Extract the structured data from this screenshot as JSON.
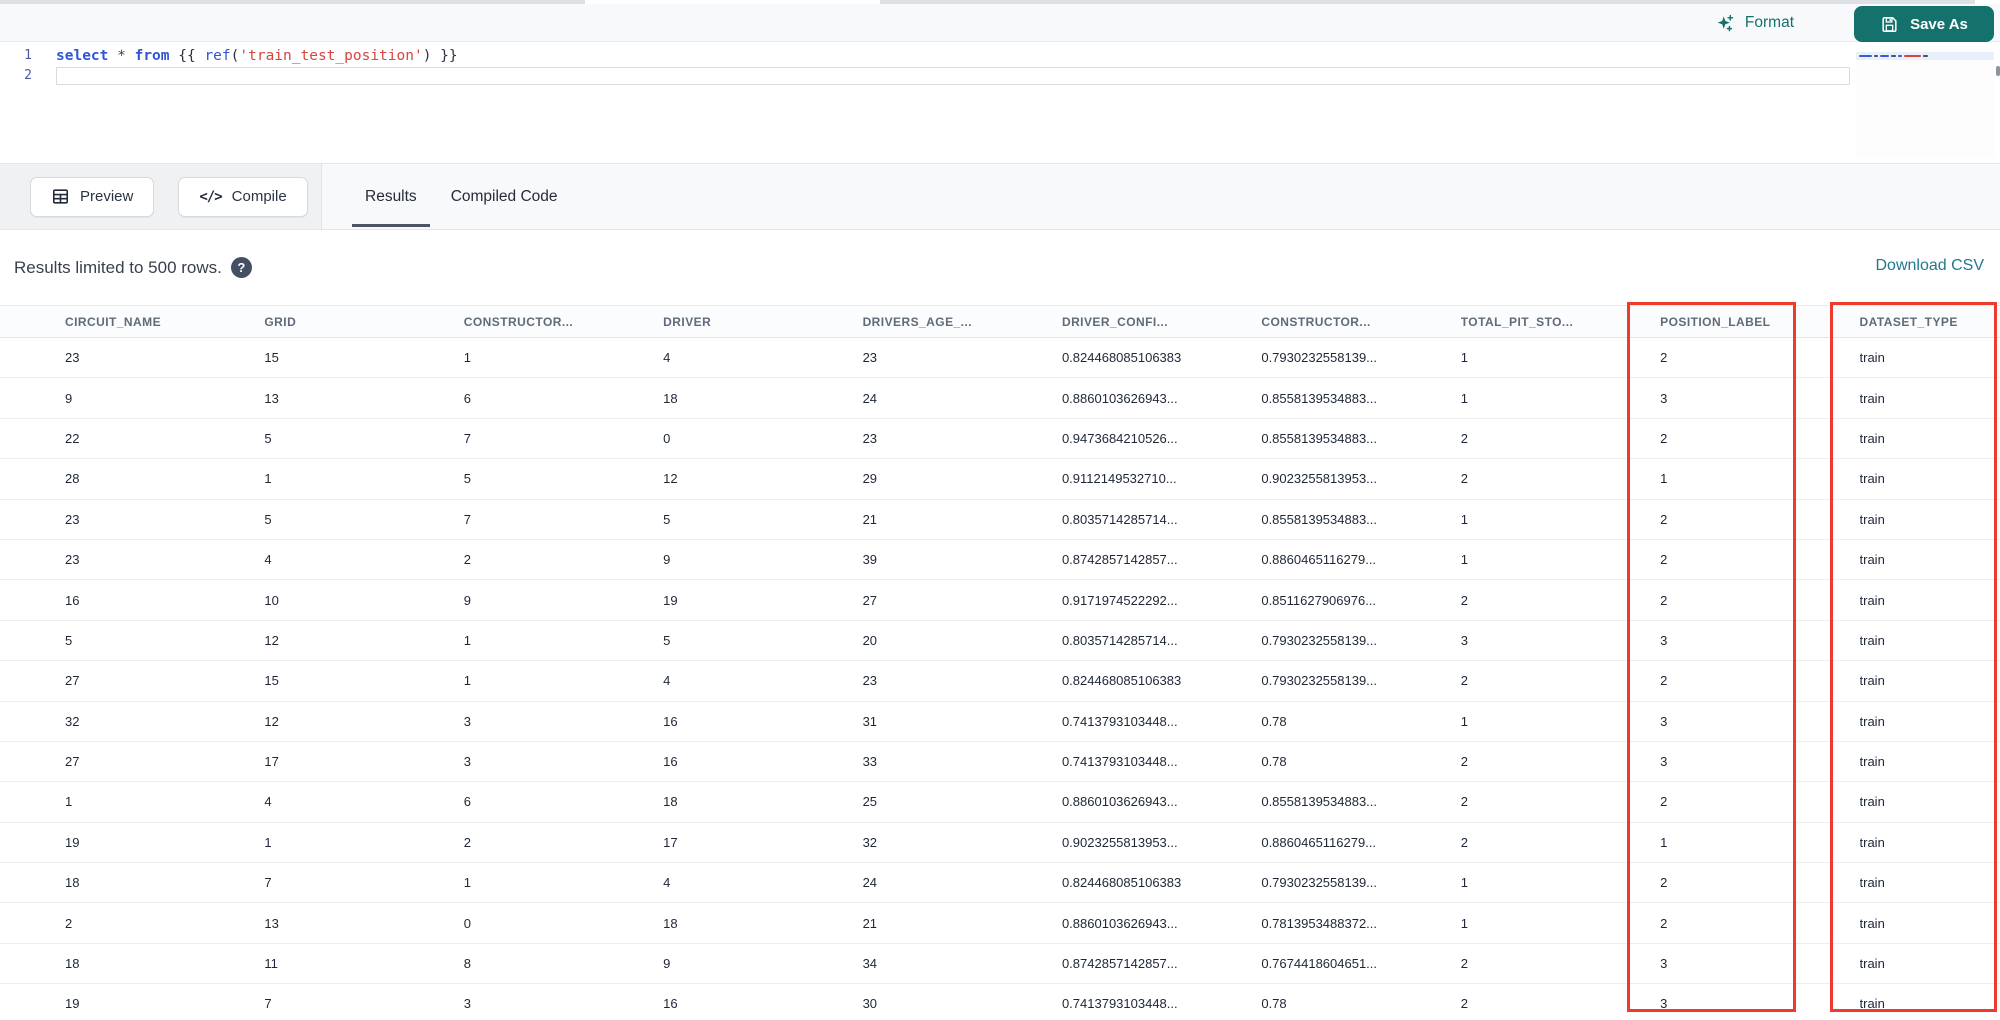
{
  "header": {
    "format_label": "Format",
    "save_as_label": "Save As",
    "accent_teal": "#15716b"
  },
  "editor": {
    "line_numbers": [
      "1",
      "2"
    ],
    "code_tokens": [
      {
        "text": "select",
        "type": "keyword"
      },
      {
        "text": " ",
        "type": "plain"
      },
      {
        "text": "*",
        "type": "operator"
      },
      {
        "text": " ",
        "type": "plain"
      },
      {
        "text": "from",
        "type": "keyword"
      },
      {
        "text": " {{ ",
        "type": "brace"
      },
      {
        "text": "ref",
        "type": "function"
      },
      {
        "text": "(",
        "type": "brace"
      },
      {
        "text": "'train_test_position'",
        "type": "string"
      },
      {
        "text": ") ",
        "type": "brace"
      },
      {
        "text": "}}",
        "type": "brace"
      }
    ]
  },
  "toolbar": {
    "preview_label": "Preview",
    "compile_label": "Compile",
    "compile_glyph": "</>",
    "tabs": [
      {
        "label": "Results",
        "active": true
      },
      {
        "label": "Compiled Code",
        "active": false
      }
    ]
  },
  "results": {
    "limit_note": "Results limited to 500 rows.",
    "help_glyph": "?",
    "download_label": "Download CSV"
  },
  "table": {
    "columns": [
      "CIRCUIT_NAME",
      "GRID",
      "CONSTRUCTOR...",
      "DRIVER",
      "DRIVERS_AGE_...",
      "DRIVER_CONFI...",
      "CONSTRUCTOR...",
      "TOTAL_PIT_STO...",
      "POSITION_LABEL",
      "DATASET_TYPE"
    ],
    "rows": [
      [
        "23",
        "15",
        "1",
        "4",
        "23",
        "0.824468085106383",
        "0.7930232558139...",
        "1",
        "2",
        "train"
      ],
      [
        "9",
        "13",
        "6",
        "18",
        "24",
        "0.8860103626943...",
        "0.8558139534883...",
        "1",
        "3",
        "train"
      ],
      [
        "22",
        "5",
        "7",
        "0",
        "23",
        "0.9473684210526...",
        "0.8558139534883...",
        "2",
        "2",
        "train"
      ],
      [
        "28",
        "1",
        "5",
        "12",
        "29",
        "0.9112149532710...",
        "0.9023255813953...",
        "2",
        "1",
        "train"
      ],
      [
        "23",
        "5",
        "7",
        "5",
        "21",
        "0.8035714285714...",
        "0.8558139534883...",
        "1",
        "2",
        "train"
      ],
      [
        "23",
        "4",
        "2",
        "9",
        "39",
        "0.8742857142857...",
        "0.8860465116279...",
        "1",
        "2",
        "train"
      ],
      [
        "16",
        "10",
        "9",
        "19",
        "27",
        "0.9171974522292...",
        "0.8511627906976...",
        "2",
        "2",
        "train"
      ],
      [
        "5",
        "12",
        "1",
        "5",
        "20",
        "0.8035714285714...",
        "0.7930232558139...",
        "3",
        "3",
        "train"
      ],
      [
        "27",
        "15",
        "1",
        "4",
        "23",
        "0.824468085106383",
        "0.7930232558139...",
        "2",
        "2",
        "train"
      ],
      [
        "32",
        "12",
        "3",
        "16",
        "31",
        "0.7413793103448...",
        "0.78",
        "1",
        "3",
        "train"
      ],
      [
        "27",
        "17",
        "3",
        "16",
        "33",
        "0.7413793103448...",
        "0.78",
        "2",
        "3",
        "train"
      ],
      [
        "1",
        "4",
        "6",
        "18",
        "25",
        "0.8860103626943...",
        "0.8558139534883...",
        "2",
        "2",
        "train"
      ],
      [
        "19",
        "1",
        "2",
        "17",
        "32",
        "0.9023255813953...",
        "0.8860465116279...",
        "2",
        "1",
        "train"
      ],
      [
        "18",
        "7",
        "1",
        "4",
        "24",
        "0.824468085106383",
        "0.7930232558139...",
        "1",
        "2",
        "train"
      ],
      [
        "2",
        "13",
        "0",
        "18",
        "21",
        "0.8860103626943...",
        "0.7813953488372...",
        "1",
        "2",
        "train"
      ],
      [
        "18",
        "11",
        "8",
        "9",
        "34",
        "0.8742857142857...",
        "0.7674418604651...",
        "2",
        "3",
        "train"
      ],
      [
        "19",
        "7",
        "3",
        "16",
        "30",
        "0.7413793103448...",
        "0.78",
        "2",
        "3",
        "train"
      ]
    ],
    "highlight_color": "#ef3b2d",
    "highlighted_columns": [
      "POSITION_LABEL",
      "DATASET_TYPE"
    ]
  }
}
